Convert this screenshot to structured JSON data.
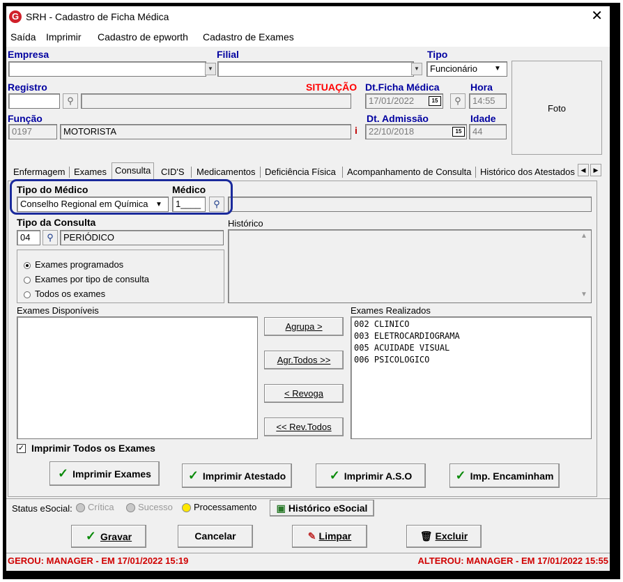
{
  "window": {
    "title": "SRH - Cadastro de Ficha Médica",
    "close": "✕"
  },
  "menu": [
    "Saída",
    "Imprimir",
    "Cadastro de epworth",
    "Cadastro de Exames"
  ],
  "header": {
    "empresa_label": "Empresa",
    "filial_label": "Filial",
    "tipo_label": "Tipo",
    "tipo_value": "Funcionário",
    "registro_label": "Registro",
    "situacao_label": "SITUAÇÃO",
    "dt_ficha_label": "Dt.Ficha Médica",
    "dt_ficha_value": "17/01/2022",
    "hora_label": "Hora",
    "hora_value": "14:55",
    "funcao_label": "Função",
    "funcao_code": "0197",
    "funcao_name": "MOTORISTA",
    "info_icon": "i",
    "dt_admissao_label": "Dt. Admissão",
    "dt_admissao_value": "22/10/2018",
    "idade_label": "Idade",
    "idade_value": "44",
    "foto_label": "Foto",
    "cal_icon": "15"
  },
  "tabs": [
    "Enfermagem",
    "Exames",
    "Consulta",
    "CID'S",
    "Medicamentos",
    "Deficiência Física",
    "Acompanhamento de Consulta",
    "Histórico dos Atestados"
  ],
  "consulta": {
    "tipo_medico_label": "Tipo do Médico",
    "tipo_medico_value": "Conselho Regional em Química",
    "medico_label": "Médico",
    "medico_value": "1____",
    "tipo_consulta_label": "Tipo da Consulta",
    "tipo_consulta_code": "04",
    "tipo_consulta_name": "PERIÓDICO",
    "historico_label": "Histórico",
    "radios": [
      "Exames programados",
      "Exames por tipo de consulta",
      "Todos os exames"
    ],
    "exames_disp_label": "Exames Disponíveis",
    "exames_real_label": "Exames Realizados",
    "exames_realizados": [
      "002 CLINICO",
      "003 ELETROCARDIOGRAMA",
      "005 ACUIDADE VISUAL",
      "006 PSICOLOGICO"
    ],
    "btn_agrupa": "Agrupa >",
    "btn_agr_todos": "Agr.Todos >>",
    "btn_revoga": "< Revoga",
    "btn_rev_todos": "<< Rev.Todos",
    "imprimir_todos_label": "Imprimir Todos os Exames",
    "checkmark": "✓",
    "btn_imp_exames": "Imprimir Exames",
    "btn_imp_atestado": "Imprimir Atestado",
    "btn_imp_aso": "Imprimir A.S.O",
    "btn_imp_encaminham": "Imp. Encaminham"
  },
  "status": {
    "label": "Status eSocial:",
    "critica": "Crítica",
    "sucesso": "Sucesso",
    "processamento": "Processamento",
    "historico_btn": "Histórico eSocial"
  },
  "actions": {
    "gravar": "Gravar",
    "cancelar": "Cancelar",
    "limpar": "Limpar",
    "excluir": "Excluir"
  },
  "footer": {
    "gerou": "GEROU: MANAGER - EM 17/01/2022 15:19",
    "alterou": "ALTEROU: MANAGER - EM 17/01/2022 15:55"
  },
  "colors": {
    "label_blue": "#0000a0",
    "situacao_red": "#ff0000",
    "footer_red": "#d00000",
    "highlight": "#1a2a9c",
    "check_green": "#0a8a0a"
  }
}
